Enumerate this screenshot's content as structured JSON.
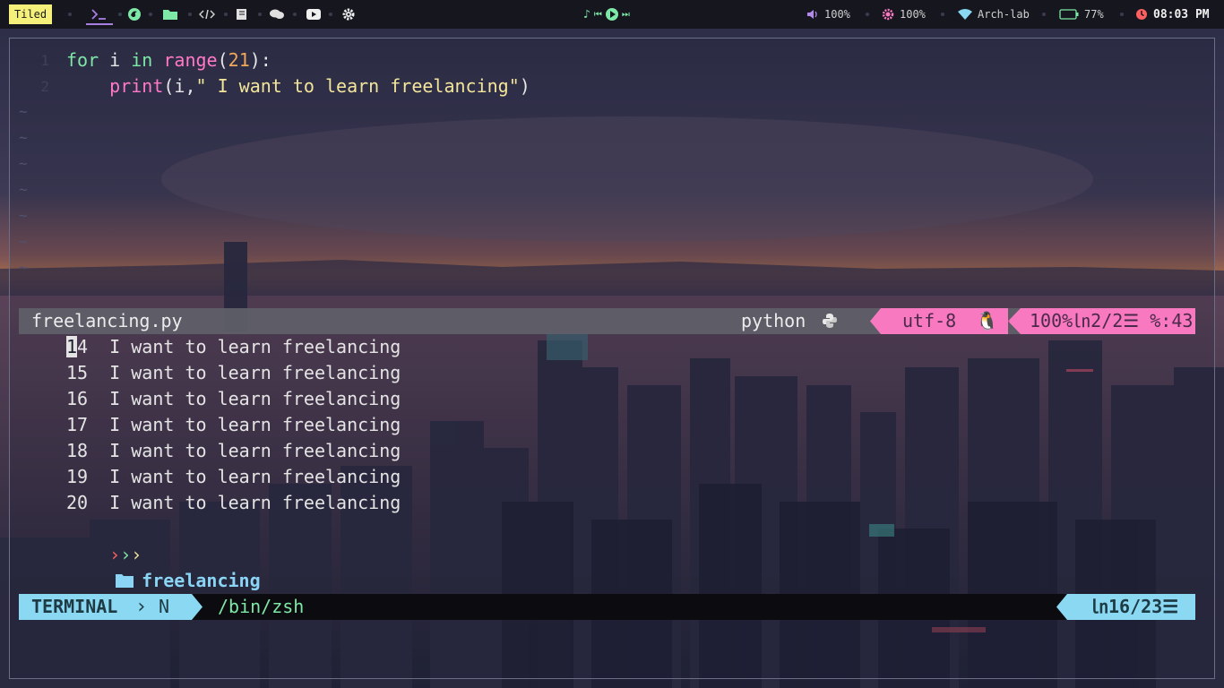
{
  "topbar": {
    "layout_badge": "Tiled",
    "workspaces": [
      {
        "icon": "terminal-icon",
        "active": true
      },
      {
        "icon": "firefox-icon"
      },
      {
        "icon": "folder-icon"
      },
      {
        "icon": "code-icon"
      },
      {
        "icon": "book-icon"
      },
      {
        "icon": "chat-icon"
      },
      {
        "icon": "youtube-icon"
      },
      {
        "icon": "gear-icon"
      }
    ],
    "media": {
      "controls": [
        "music-note-icon",
        "previous-icon",
        "play-icon",
        "next-icon"
      ]
    },
    "volume": "100%",
    "brightness": "100%",
    "network": "Arch-lab",
    "battery": "77%",
    "clock": "08:03 PM"
  },
  "editor": {
    "code_lines": [
      {
        "number": "1",
        "tokens": [
          [
            "kw",
            "for"
          ],
          [
            "plain",
            " i "
          ],
          [
            "kw",
            "in"
          ],
          [
            "plain",
            " "
          ],
          [
            "fn",
            "range"
          ],
          [
            "plain",
            "("
          ],
          [
            "num",
            "21"
          ],
          [
            "plain",
            "):"
          ]
        ]
      },
      {
        "number": "2",
        "tokens": [
          [
            "plain",
            "    "
          ],
          [
            "fn",
            "print"
          ],
          [
            "plain",
            "(i,"
          ],
          [
            "str",
            "\" I want to learn freelancing\""
          ],
          [
            "plain",
            ")"
          ]
        ]
      }
    ],
    "empty_marker": "~"
  },
  "statusline": {
    "filename": "freelancing.py",
    "filetype": "python",
    "encoding": "utf-8",
    "position": "100%㏑2/2☰ %:43"
  },
  "terminal": {
    "output_lines": [
      {
        "num": "14",
        "text": "I want to learn freelancing"
      },
      {
        "num": "15",
        "text": "I want to learn freelancing"
      },
      {
        "num": "16",
        "text": "I want to learn freelancing"
      },
      {
        "num": "17",
        "text": "I want to learn freelancing"
      },
      {
        "num": "18",
        "text": "I want to learn freelancing"
      },
      {
        "num": "19",
        "text": "I want to learn freelancing"
      },
      {
        "num": "20",
        "text": "I want to learn freelancing"
      }
    ],
    "prompt_dir": "freelancing"
  },
  "termbar": {
    "mode": "TERMINAL",
    "sub_mode": "N",
    "shell": "/bin/zsh",
    "position": "㏑16/23☰"
  },
  "colors": {
    "accent_pink": "#f879bf",
    "accent_cyan": "#8ad8f2",
    "keyword_green": "#7ee8a6",
    "badge_yellow": "#f4f07a"
  }
}
